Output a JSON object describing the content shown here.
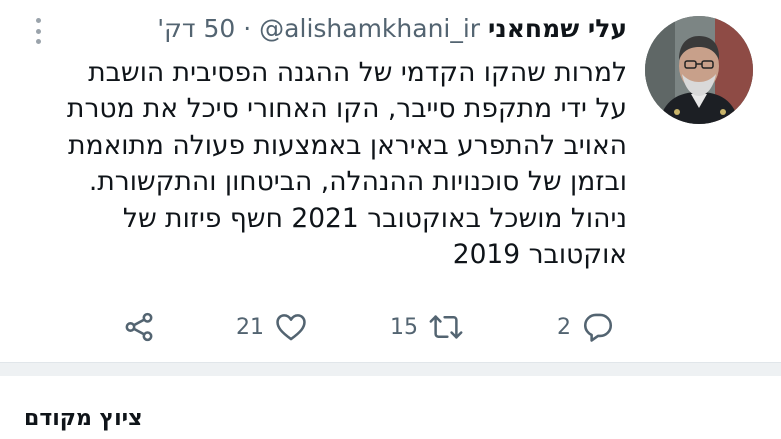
{
  "tweet": {
    "author_name": "עלי שמחאני",
    "handle": "@alishamkhani_ir",
    "separator": "·",
    "time": "50 דק'",
    "body_lines": [
      "למרות שהקו הקדמי של ההגנה הפסיבית הושבת",
      "על ידי מתקפת סייבר, הקו האחורי סיכל את מטרת",
      "האויב להתפרע באיראן באמצעות פעולה מתואמת",
      "ובזמן של סוכנויות ההנהלה, הביטחון והתקשורת.",
      "ניהול מושכל באוקטובר 2021 חשף פיזות של",
      "אוקטובר 2019"
    ],
    "actions": {
      "reply_count": "2",
      "retweet_count": "15",
      "like_count": "21"
    }
  },
  "icons": {
    "more": "more-vertical-icon",
    "reply": "reply-bubble-icon",
    "retweet": "retweet-icon",
    "like": "heart-icon",
    "share": "share-icon"
  },
  "colors": {
    "text_primary": "#0f1419",
    "text_secondary": "#536471",
    "divider": "#eef1f3"
  },
  "section": {
    "title": "ציוץ מקודם"
  }
}
